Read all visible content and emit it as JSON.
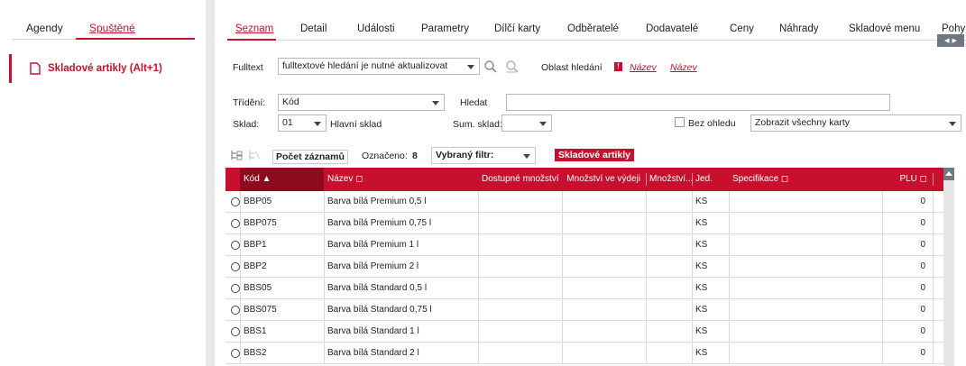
{
  "left_panel": {
    "tabs": [
      "Agendy",
      "Spuštěné"
    ],
    "active_tab": "Spuštěné",
    "items": [
      {
        "label": "Skladové artikly (Alt+1)",
        "icon": "document-icon"
      }
    ]
  },
  "main": {
    "tabs": [
      "Seznam",
      "Detail",
      "Události",
      "Parametry",
      "Dílčí karty",
      "Odběratelé",
      "Dodavatelé",
      "Ceny",
      "Náhrady",
      "Skladové menu",
      "Pohyb"
    ],
    "active_tab": "Seznam",
    "filters": {
      "fulltext_label": "Fulltext",
      "fulltext_value": "fulltextové hledání je nutné aktualizovat",
      "search_area_label": "Oblast hledání",
      "search_area_badge": "!",
      "search_area_links": [
        "Název",
        "Název"
      ],
      "sort_label": "Třídění:",
      "sort_value": "Kód",
      "find_label": "Hledat",
      "find_value": "",
      "store_label": "Sklad:",
      "store_value": "01",
      "store_name": "Hlavní sklad",
      "sum_store_label": "Sum. sklad:",
      "sum_store_value": "",
      "no_regard_label": "Bez ohledu",
      "no_regard_checked": false,
      "show_cards_value": "Zobrazit všechny karty"
    },
    "toolbar": {
      "count_label": "Počet záznamů",
      "marked_label": "Označeno:",
      "marked_value": "8",
      "filter_label": "Vybraný filtr:",
      "filter_badge": "Skladové artikly"
    },
    "grid": {
      "columns": [
        {
          "key": "kod",
          "label": "Kód ▲"
        },
        {
          "key": "nazev",
          "label": "Název ◻"
        },
        {
          "key": "dostupne",
          "label": "Dostupné množství"
        },
        {
          "key": "vydej",
          "label": "Množství ve výdeji"
        },
        {
          "key": "mnozstvi",
          "label": "Množství..."
        },
        {
          "key": "jed",
          "label": "Jed."
        },
        {
          "key": "spec",
          "label": "Specifikace ◻"
        },
        {
          "key": "plu",
          "label": "PLU ◻"
        }
      ],
      "rows": [
        {
          "kod": "BBP05",
          "nazev": "Barva bílá Premium 0,5 l",
          "jed": "KS",
          "plu": "0"
        },
        {
          "kod": "BBP075",
          "nazev": "Barva bílá Premium 0,75 l",
          "jed": "KS",
          "plu": "0"
        },
        {
          "kod": "BBP1",
          "nazev": "Barva bílá Premium 1 l",
          "jed": "KS",
          "plu": "0"
        },
        {
          "kod": "BBP2",
          "nazev": "Barva bílá Premium 2 l",
          "jed": "KS",
          "plu": "0"
        },
        {
          "kod": "BBS05",
          "nazev": "Barva bílá Standard 0,5 l",
          "jed": "KS",
          "plu": "0"
        },
        {
          "kod": "BBS075",
          "nazev": "Barva bílá Standard 0,75 l",
          "jed": "KS",
          "plu": "0"
        },
        {
          "kod": "BBS1",
          "nazev": "Barva bílá Standard 1 l",
          "jed": "KS",
          "plu": "0"
        },
        {
          "kod": "BBS2",
          "nazev": "Barva bílá Standard 2 l",
          "jed": "KS",
          "plu": "0"
        }
      ]
    }
  },
  "colors": {
    "accent": "#c8102e",
    "sorted_header": "#8e0a1e",
    "scroll": "#6e7782"
  }
}
